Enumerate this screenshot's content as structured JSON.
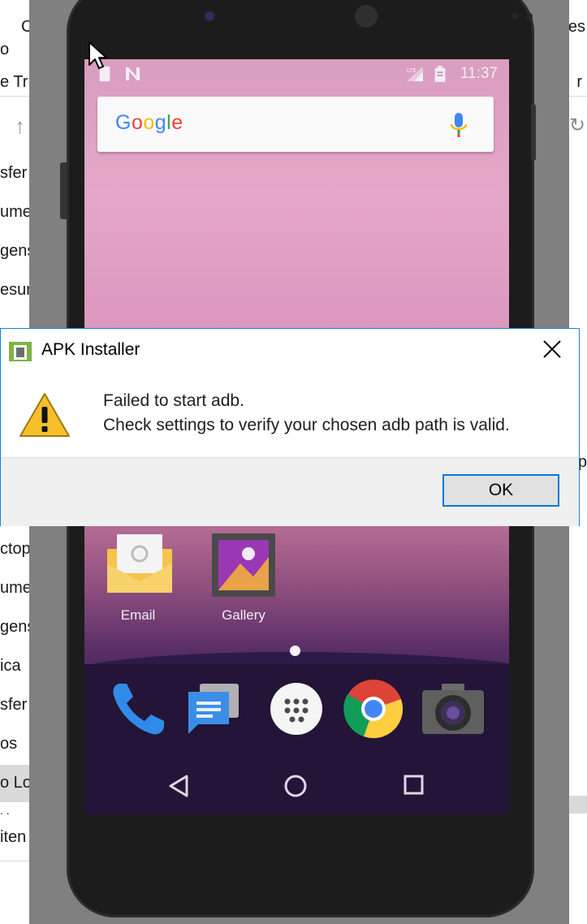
{
  "background": {
    "left_fragments": [
      "o",
      "e Tr",
      "sfer",
      "ume",
      "gens",
      "esur",
      "ctop",
      "ume",
      "gens",
      "ica",
      "sfer",
      "os",
      "o Lo",
      ". .",
      "iten"
    ],
    "right_fragments": [
      "es",
      "r",
      "p"
    ],
    "top_fragment": "C"
  },
  "phone": {
    "status_bar": {
      "time": "11:37"
    },
    "search": {
      "logo_text": "Google"
    },
    "apps": [
      {
        "label": "Email"
      },
      {
        "label": "Gallery"
      }
    ],
    "dock": [
      "phone-icon",
      "messages-icon",
      "app-drawer-icon",
      "chrome-icon",
      "camera-icon"
    ],
    "nav": [
      "back-icon",
      "home-icon",
      "recents-icon"
    ]
  },
  "dialog": {
    "title": "APK Installer",
    "message_line1": "Failed to start adb.",
    "message_line2": "Check settings to verify your chosen adb path is valid.",
    "ok_label": "OK"
  },
  "colors": {
    "dialog_border": "#1883d7",
    "ok_border": "#0078d7"
  }
}
